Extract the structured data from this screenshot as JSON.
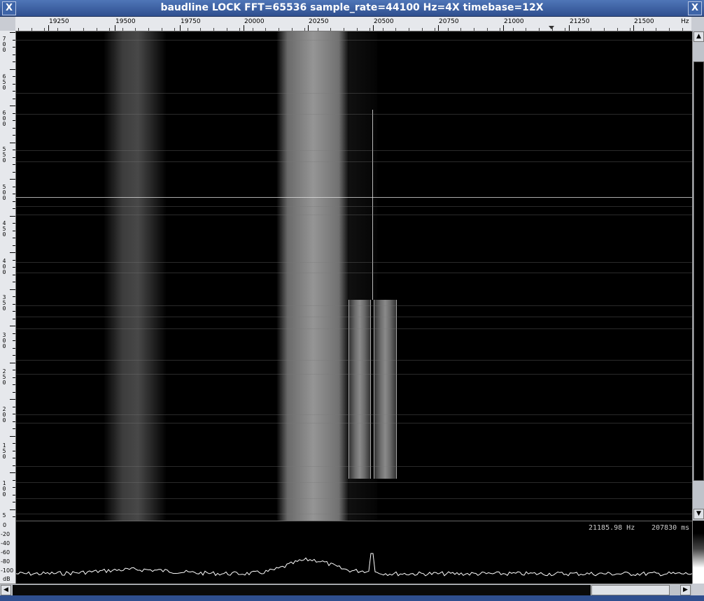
{
  "window": {
    "title": "baudline  LOCK FFT=65536 sample_rate=44100 Hz=4X timebase=12X",
    "close_glyph": "X"
  },
  "freq_axis": {
    "labels": [
      "19250",
      "19500",
      "19750",
      "20000",
      "20250",
      "20500",
      "20750",
      "21000",
      "21250",
      "21500"
    ],
    "unit": "Hz"
  },
  "time_axis": {
    "labels": [
      "7\n0\n0",
      "6\n5\n0",
      "6\n0\n0",
      "5\n5\n0",
      "5\n0\n0",
      "4\n5\n0",
      "4\n0\n0",
      "3\n5\n0",
      "3\n0\n0",
      "2\n5\n0",
      "2\n0\n0",
      "1\n5\n0",
      "1\n0\n0",
      "5"
    ]
  },
  "db_axis": {
    "labels": [
      "0",
      "-20",
      "-40",
      "-60",
      "-80",
      "-100",
      "dB"
    ]
  },
  "readout": {
    "frequency": "21185.98 Hz",
    "time": "207830 ms"
  },
  "colors": {
    "titlebar": "#3d64a8",
    "background": "#000000",
    "trace": "#ffffff"
  }
}
